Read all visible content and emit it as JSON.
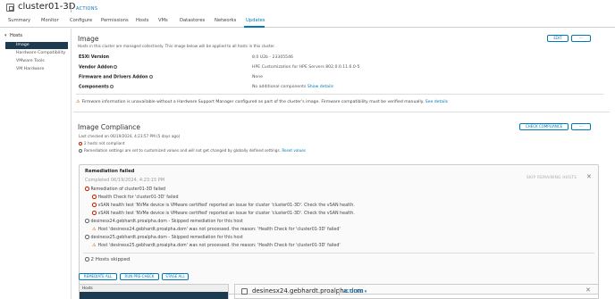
{
  "header": {
    "title": "cluster01-3D",
    "actions_label": "ACTIONS",
    "actions_chevron": "▾",
    "object_icon": "cluster-icon"
  },
  "tabs": [
    "Summary",
    "Monitor",
    "Configure",
    "Permissions",
    "Hosts",
    "VMs",
    "Datastores",
    "Networks",
    "Updates"
  ],
  "active_tab": "Updates",
  "sidebar": {
    "group": "Hosts",
    "items": [
      "Image",
      "Hardware Compatibility",
      "VMware Tools",
      "VM Hardware"
    ],
    "active_item": "Image"
  },
  "image_section": {
    "title": "Image",
    "description": "Hosts in this cluster are managed collectively. This image below will be applied to all hosts in this cluster.",
    "edit_label": "EDIT",
    "more_label": "···",
    "rows": [
      {
        "label": "ESXi Version",
        "value": "8.0 U2b - 23305546"
      },
      {
        "label": "Vendor Addon",
        "value": "HPE Customization for HPE Servers 802.0.0.11.6.0-5"
      },
      {
        "label": "Firmware and Drivers Addon",
        "value": "None"
      },
      {
        "label": "Components",
        "value": "No additional components",
        "link": "Show details"
      }
    ],
    "warning": "Firmware information is unavailable without a Hardware Support Manager configured as part of the cluster's image. Firmware compatibility must be verified manually.",
    "warning_link": "See details"
  },
  "compliance": {
    "title": "Image Compliance",
    "check_label": "CHECK COMPLIANCE",
    "more_label": "···",
    "last_checked": "Last checked on 06/19/2024, 4:23:57 PM (5 days ago)",
    "not_compliant": "2 hosts not compliant",
    "settings_note": "Remediation settings are set to customized values and will not get changed by globally defined settings.",
    "settings_link": "Reset values"
  },
  "remediation": {
    "title": "Remediation failed",
    "completed": "Completed 06/19/2024, 4:23:15 PM",
    "skip_label": "SKIP REMAINING HOSTS",
    "close": "✕",
    "lines": [
      {
        "icon": "error-icon",
        "indent": 0,
        "text": "Remediation of cluster01-3D failed"
      },
      {
        "icon": "error-icon",
        "indent": 1,
        "text": "Health Check for 'cluster01-3D' failed"
      },
      {
        "icon": "error-icon",
        "indent": 1,
        "text": "vSAN health test 'NVMe device is VMware certified' reported an issue for cluster 'cluster01-3D'. Check the vSAN health."
      },
      {
        "icon": "error-icon",
        "indent": 1,
        "text": "vSAN health test 'NVMe device is VMware certified' reported an issue for cluster 'cluster01-3D'. Check the vSAN health."
      },
      {
        "icon": "neutral-icon",
        "indent": 0,
        "text": "desinesx24.gebhardt.proalpha.dom - Skipped remediation for this host"
      },
      {
        "icon": "warning-icon",
        "indent": 1,
        "text": "Host 'desinesx24.gebhardt.proalpha.dom' was not processed. the reason: 'Health Check for 'cluster01-3D' failed'"
      },
      {
        "icon": "neutral-icon",
        "indent": 0,
        "text": "desinesx25.gebhardt.proalpha.dom - Skipped remediation for this host"
      },
      {
        "icon": "warning-icon",
        "indent": 1,
        "text": "Host 'desinesx25.gebhardt.proalpha.dom' was not processed. the reason: 'Health Check for 'cluster01-3D' failed'"
      }
    ],
    "skipped": "2 Hosts skipped"
  },
  "bottom": {
    "buttons": [
      "REMEDIATE ALL",
      "RUN PRE-CHECK",
      "STAGE ALL"
    ],
    "list_header": "Hosts",
    "detail_title": "desinesx24.gebhardt.proalpha.dom",
    "detail_actions": "ACTIONS",
    "detail_chevron": "▾",
    "detail_close": "✕"
  },
  "colors": {
    "accent": "#0079b8",
    "sidebar_active": "#1c3b4f",
    "error": "#c92100",
    "warning": "#c25400"
  }
}
